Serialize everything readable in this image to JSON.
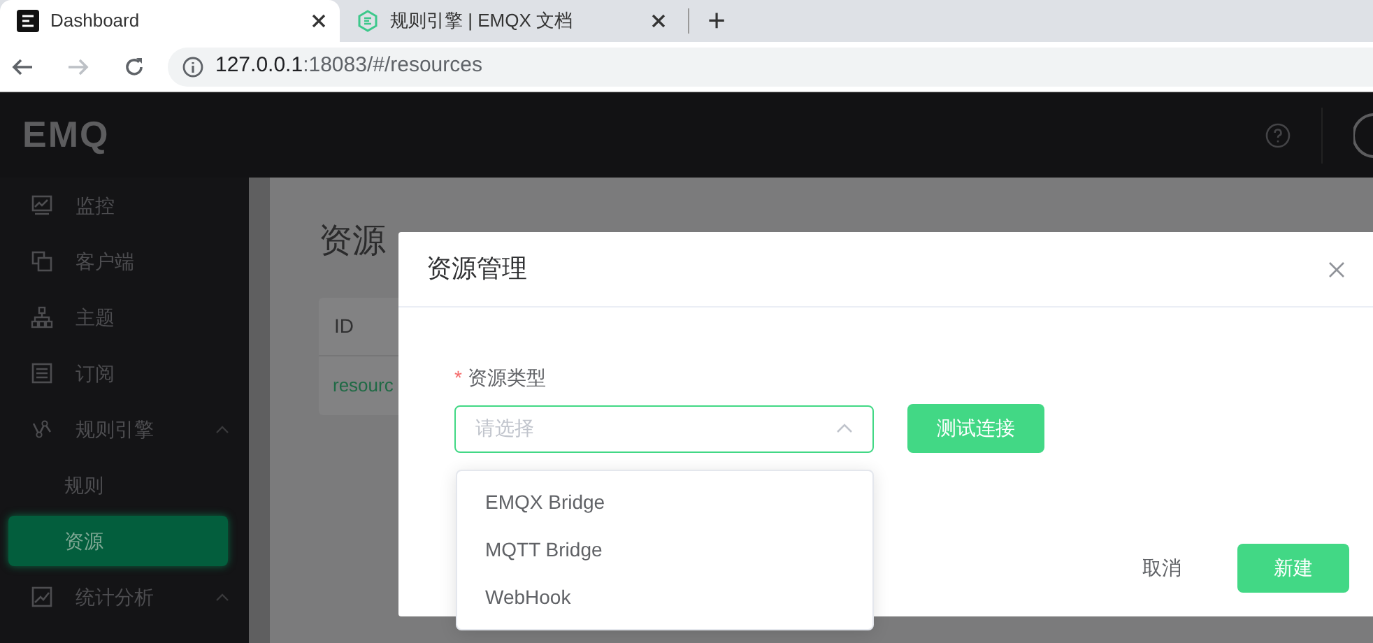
{
  "browser": {
    "tabs": [
      {
        "title": "Dashboard",
        "selected": true
      },
      {
        "title": "规则引擎 | EMQX 文档",
        "selected": false
      }
    ],
    "new_tab": "+",
    "address": {
      "host": "127.0.0.1",
      "rest": ":18083/#/resources"
    }
  },
  "header": {
    "logo": "EMQ"
  },
  "sidebar": {
    "items": [
      {
        "label": "监控",
        "selected": false
      },
      {
        "label": "客户端",
        "selected": false
      },
      {
        "label": "主题",
        "selected": false
      },
      {
        "label": "订阅",
        "selected": false
      },
      {
        "label": "规则引擎",
        "expanded": true,
        "selected": false,
        "children": [
          {
            "label": "规则",
            "selected": false
          },
          {
            "label": "资源",
            "selected": true
          }
        ]
      },
      {
        "label": "统计分析",
        "expanded": true,
        "selected": false
      }
    ]
  },
  "page": {
    "title": "资源",
    "table": {
      "columns": [
        "ID"
      ],
      "rows": [
        [
          "resourc"
        ]
      ]
    }
  },
  "modal": {
    "title": "资源管理",
    "field": {
      "label": "资源类型",
      "required_mark": "*",
      "placeholder": "请选择",
      "expanded": true,
      "options": [
        "EMQX Bridge",
        "MQTT Bridge",
        "WebHook"
      ]
    },
    "test_button": "测试连接",
    "cancel": "取消",
    "submit": "新建"
  }
}
